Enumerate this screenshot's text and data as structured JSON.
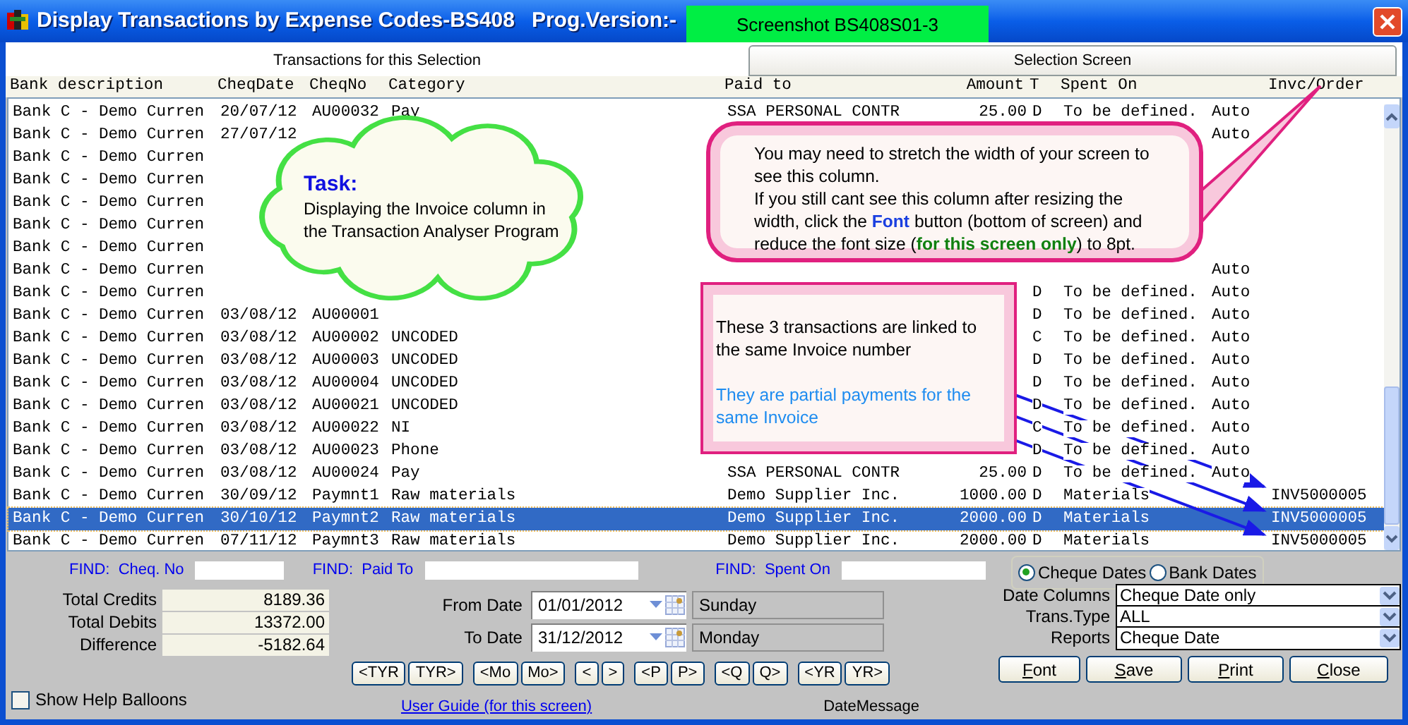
{
  "window": {
    "title": "Display Transactions by Expense Codes-BS408",
    "version_label": "Prog.Version:-"
  },
  "screenshot_label": "Screenshot BS408S01-3",
  "tabs": [
    {
      "label": "Transactions for this Selection",
      "selected": true
    },
    {
      "label": "Selection Screen",
      "selected": false
    }
  ],
  "table": {
    "header": {
      "bank": "Bank description",
      "date": "CheqDate",
      "cheq_no": "CheqNo",
      "category": "Category",
      "paid_to": "Paid to",
      "amount": "Amount",
      "t": "T",
      "spent_on": "Spent On",
      "invoice": "Invc/Order"
    },
    "rows": [
      {
        "selected": false,
        "bank": "Bank C - Demo Curren",
        "date": "20/07/12",
        "cheq_no": "AU00032",
        "category": "Pay",
        "paid_to": "SSA PERSONAL CONTR",
        "amount": "25.00",
        "t": "D",
        "spent_on": "To be defined.",
        "column_9": "Auto"
      },
      {
        "selected": false,
        "bank": "Bank C - Demo Curren",
        "date": "27/07/12",
        "column_9": "Auto"
      },
      {
        "selected": false,
        "bank": "Bank C - Demo Curren"
      },
      {
        "selected": false,
        "bank": "Bank C - Demo Curren"
      },
      {
        "selected": false,
        "bank": "Bank C - Demo Curren"
      },
      {
        "selected": false,
        "bank": "Bank C - Demo Curren"
      },
      {
        "selected": false,
        "bank": "Bank C - Demo Curren"
      },
      {
        "selected": false,
        "bank": "Bank C - Demo Curren",
        "column_9": "Auto"
      },
      {
        "selected": false,
        "bank": "Bank C - Demo Curren",
        "t": "D",
        "spent_on": "To be defined.",
        "column_9": "Auto"
      },
      {
        "selected": false,
        "bank": "Bank C - Demo Curren",
        "date": "03/08/12",
        "cheq_no": "AU00001",
        "t": "D",
        "spent_on": "To be defined.",
        "column_9": "Auto"
      },
      {
        "selected": false,
        "bank": "Bank C - Demo Curren",
        "date": "03/08/12",
        "cheq_no": "AU00002",
        "category": "UNCODED",
        "t": "C",
        "spent_on": "To be defined.",
        "column_9": "Auto"
      },
      {
        "selected": false,
        "bank": "Bank C - Demo Curren",
        "date": "03/08/12",
        "cheq_no": "AU00003",
        "category": "UNCODED",
        "t": "D",
        "spent_on": "To be defined.",
        "column_9": "Auto"
      },
      {
        "selected": false,
        "bank": "Bank C - Demo Curren",
        "date": "03/08/12",
        "cheq_no": "AU00004",
        "category": "UNCODED",
        "t": "D",
        "spent_on": "To be defined.",
        "column_9": "Auto"
      },
      {
        "selected": false,
        "bank": "Bank C - Demo Curren",
        "date": "03/08/12",
        "cheq_no": "AU00021",
        "category": "UNCODED",
        "t": "D",
        "spent_on": "To be defined.",
        "column_9": "Auto"
      },
      {
        "selected": false,
        "bank": "Bank C - Demo Curren",
        "date": "03/08/12",
        "cheq_no": "AU00022",
        "category": "NI",
        "t": "C",
        "spent_on": "To be defined.",
        "column_9": "Auto"
      },
      {
        "selected": false,
        "bank": "Bank C - Demo Curren",
        "date": "03/08/12",
        "cheq_no": "AU00023",
        "category": "Phone",
        "t": "D",
        "spent_on": "To be defined.",
        "column_9": "Auto"
      },
      {
        "selected": false,
        "bank": "Bank C - Demo Curren",
        "date": "03/08/12",
        "cheq_no": "AU00024",
        "category": "Pay",
        "paid_to": "SSA PERSONAL CONTR",
        "amount": "25.00",
        "t": "D",
        "spent_on": "To be defined.",
        "column_9": "Auto"
      },
      {
        "selected": false,
        "bank": "Bank C - Demo Curren",
        "date": "30/09/12",
        "cheq_no": "Paymnt1",
        "category": "Raw materials",
        "paid_to": "Demo Supplier Inc.",
        "amount": "1000.00",
        "t": "D",
        "spent_on": "Materials",
        "invoice": "INV5000005"
      },
      {
        "selected": true,
        "bank": "Bank C - Demo Curren",
        "date": "30/10/12",
        "cheq_no": "Paymnt2",
        "category": "Raw materials",
        "paid_to": "Demo Supplier Inc.",
        "amount": "2000.00",
        "t": "D",
        "spent_on": "Materials",
        "invoice": "INV5000005"
      },
      {
        "selected": false,
        "bank": "Bank C - Demo Curren",
        "date": "07/11/12",
        "cheq_no": "Paymnt3",
        "category": "Raw materials",
        "paid_to": "Demo Supplier Inc.",
        "amount": "2000.00",
        "t": "D",
        "spent_on": "Materials",
        "invoice": "INV5000005"
      }
    ]
  },
  "find": [
    {
      "label": "FIND:  Cheq. No"
    },
    {
      "label": "FIND:  Paid To"
    },
    {
      "label": "FIND:  Spent On"
    }
  ],
  "date_mode": [
    {
      "label": "Cheque Dates",
      "selected": true
    },
    {
      "label": "Bank Dates",
      "selected": false
    }
  ],
  "totals": [
    {
      "label": "Total Credits",
      "value": "8189.36"
    },
    {
      "label": "Total Debits",
      "value": "13372.00"
    },
    {
      "label": "Difference",
      "value": "-5182.64"
    }
  ],
  "dates": [
    {
      "label": "From Date",
      "value": "01/01/2012",
      "day": "Sunday"
    },
    {
      "label": "To Date",
      "value": "31/12/2012",
      "day": "Monday"
    }
  ],
  "nav_buttons": [
    "<TYR",
    "TYR>",
    "<Mo",
    "Mo>",
    "<",
    ">",
    "<P",
    "P>",
    "<Q",
    "Q>",
    "<YR",
    "YR>"
  ],
  "selects": [
    {
      "label": "Date Columns",
      "value": "Cheque Date only"
    },
    {
      "label": "Trans.Type",
      "value": "ALL"
    },
    {
      "label": "Reports",
      "value": "Cheque Date"
    }
  ],
  "show_help_balloons": {
    "label": "Show Help Balloons",
    "checked": false
  },
  "user_guide_link": "User Guide (for this screen)",
  "date_message": "DateMessage",
  "action_buttons": [
    "Font",
    "Save",
    "Print",
    "Close"
  ],
  "task_note": {
    "title": "Task:",
    "text": "Displaying the Invoice column in the Transaction Analyser Program"
  },
  "column_note": {
    "paragraphs": [
      [
        {
          "kind": "plain",
          "text": "You may need to stretch the width of your screen to see this column."
        }
      ],
      [
        {
          "kind": "plain",
          "text": "If you still cant see this column after resizing the width, click the "
        },
        {
          "kind": "keyword",
          "text": "Font"
        },
        {
          "kind": "plain",
          "text": " button (bottom of screen) and reduce the font size ("
        },
        {
          "kind": "emphasis",
          "text": "for this screen only"
        },
        {
          "kind": "plain",
          "text": ") to 8pt."
        }
      ]
    ]
  },
  "invoice_note": {
    "paragraphs": [
      {
        "kind": "plain",
        "text": "These 3 transactions are linked to the same Invoice number"
      },
      {
        "kind": "highlight",
        "text": "They are partial payments for the same Invoice"
      }
    ]
  }
}
